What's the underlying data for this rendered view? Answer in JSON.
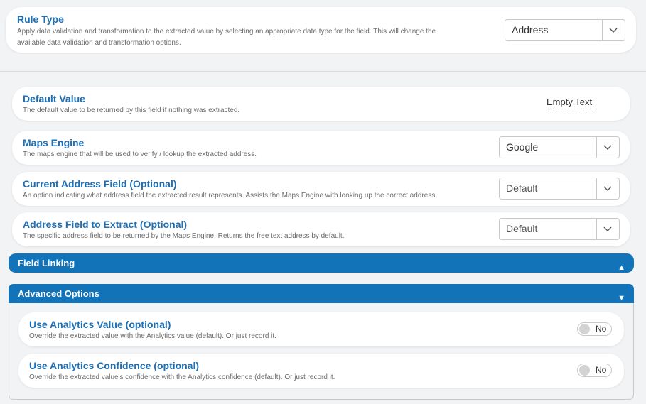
{
  "rule_type": {
    "title": "Rule Type",
    "description": "Apply data validation and transformation to the extracted value by selecting an appropriate data type for the field. This will change the available data validation and transformation options.",
    "value": "Address"
  },
  "default_value": {
    "title": "Default Value",
    "description": "The default value to be returned by this field if nothing was extracted.",
    "value": "Empty Text"
  },
  "maps_engine": {
    "title": "Maps Engine",
    "description": "The maps engine that will be used to verify / lookup the extracted address.",
    "value": "Google"
  },
  "current_address_field": {
    "title": "Current Address Field (Optional)",
    "description": "An option indicating what address field the extracted result represents. Assists the Maps Engine with looking up the correct address.",
    "value": "Default"
  },
  "address_field_to_extract": {
    "title": "Address Field to Extract (Optional)",
    "description": "The specific address field to be returned by the Maps Engine. Returns the free text address by default.",
    "value": "Default"
  },
  "field_linking": {
    "label": "Field Linking",
    "icon": "triangle-up-icon"
  },
  "advanced_options": {
    "label": "Advanced Options",
    "icon": "triangle-down-icon",
    "use_analytics_value": {
      "title": "Use Analytics Value (optional)",
      "description": "Override the extracted value with the Analytics value (default). Or just record it.",
      "toggle": "No"
    },
    "use_analytics_confidence": {
      "title": "Use Analytics Confidence (optional)",
      "description": "Override the extracted value's confidence with the Analytics confidence (default). Or just record it.",
      "toggle": "No"
    }
  },
  "colors": {
    "accent": "#1373b9",
    "title": "#1d6fb6",
    "background": "#f2f3f5"
  }
}
